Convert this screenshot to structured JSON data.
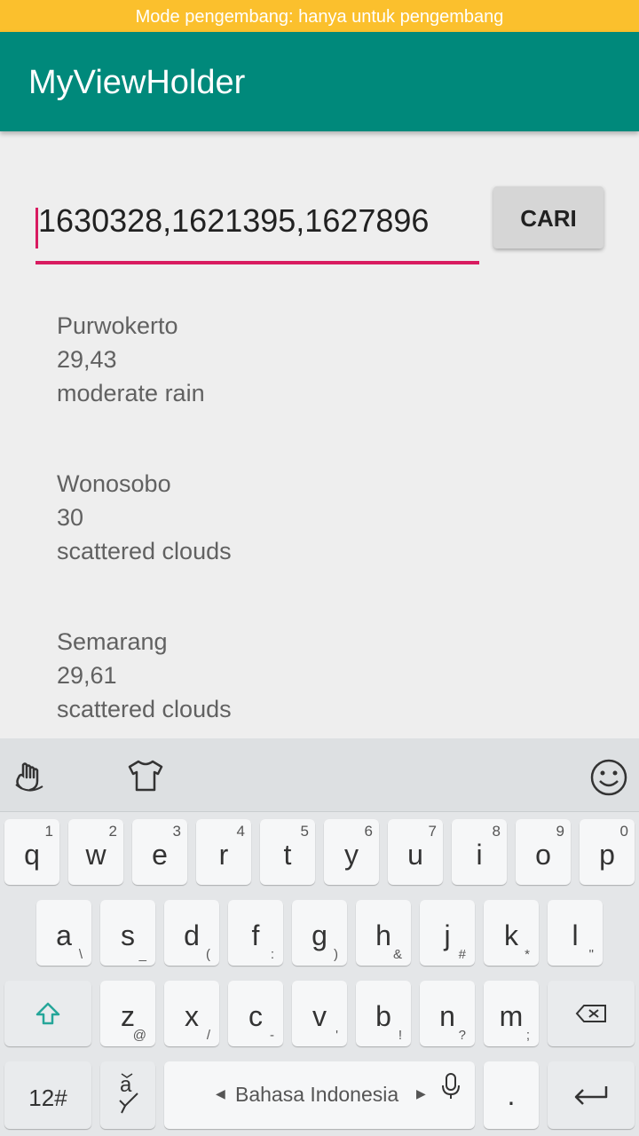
{
  "status_bar": {
    "dev_notice": "Mode pengembang: hanya untuk pengembang"
  },
  "app_bar": {
    "title": "MyViewHolder"
  },
  "search": {
    "value": "1630328,1621395,1627896",
    "button_label": "CARI"
  },
  "results": [
    {
      "city": "Purwokerto",
      "temp": "29,43",
      "desc": "moderate rain"
    },
    {
      "city": "Wonosobo",
      "temp": "30",
      "desc": "scattered clouds"
    },
    {
      "city": "Semarang",
      "temp": "29,61",
      "desc": "scattered clouds"
    }
  ],
  "keyboard": {
    "row1": [
      {
        "k": "q",
        "n": "1"
      },
      {
        "k": "w",
        "n": "2"
      },
      {
        "k": "e",
        "n": "3"
      },
      {
        "k": "r",
        "n": "4"
      },
      {
        "k": "t",
        "n": "5"
      },
      {
        "k": "y",
        "n": "6"
      },
      {
        "k": "u",
        "n": "7"
      },
      {
        "k": "i",
        "n": "8"
      },
      {
        "k": "o",
        "n": "9"
      },
      {
        "k": "p",
        "n": "0"
      }
    ],
    "row2": [
      {
        "k": "a",
        "s": "\\"
      },
      {
        "k": "s",
        "s": "_"
      },
      {
        "k": "d",
        "s": "("
      },
      {
        "k": "f",
        "s": ":"
      },
      {
        "k": "g",
        "s": ")"
      },
      {
        "k": "h",
        "s": "&"
      },
      {
        "k": "j",
        "s": "#"
      },
      {
        "k": "k",
        "s": "*"
      },
      {
        "k": "l",
        "s": "\""
      }
    ],
    "row3": [
      {
        "k": "z",
        "s": "@"
      },
      {
        "k": "x",
        "s": "/"
      },
      {
        "k": "c",
        "s": "-"
      },
      {
        "k": "v",
        "s": "'"
      },
      {
        "k": "b",
        "s": "!"
      },
      {
        "k": "n",
        "s": "?"
      },
      {
        "k": "m",
        "s": ";"
      }
    ],
    "symbols_label": "12#",
    "language_label": "Bahasa Indonesia",
    "period_label": "."
  }
}
